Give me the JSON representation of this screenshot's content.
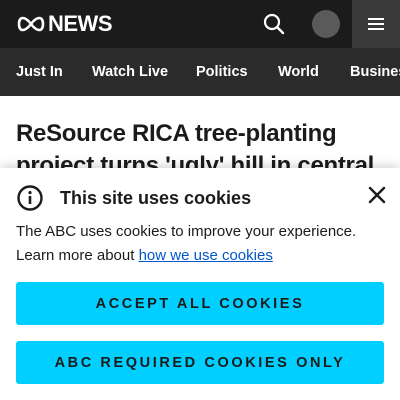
{
  "header": {
    "logo_text": "NEWS",
    "logo_icon": "abc-lissajous-logo",
    "search_icon": "search-icon",
    "menu_icon": "hamburger-menu-icon",
    "bar_color": "#1b1b1b"
  },
  "nav": {
    "items": [
      "Just In",
      "Watch Live",
      "Politics",
      "World",
      "Business"
    ]
  },
  "article": {
    "headline": "ReSource RICA tree-planting project turns 'ugly' hill in central"
  },
  "cookie_banner": {
    "title": "This site uses cookies",
    "body_text": "The ABC uses cookies to improve your experience. Learn more about ",
    "link_text": "how we use cookies",
    "accept_all_label": "ACCEPT ALL COOKIES",
    "required_only_label": "ABC REQUIRED COOKIES ONLY",
    "button_color": "#00cfff",
    "link_color": "#0058cc"
  }
}
